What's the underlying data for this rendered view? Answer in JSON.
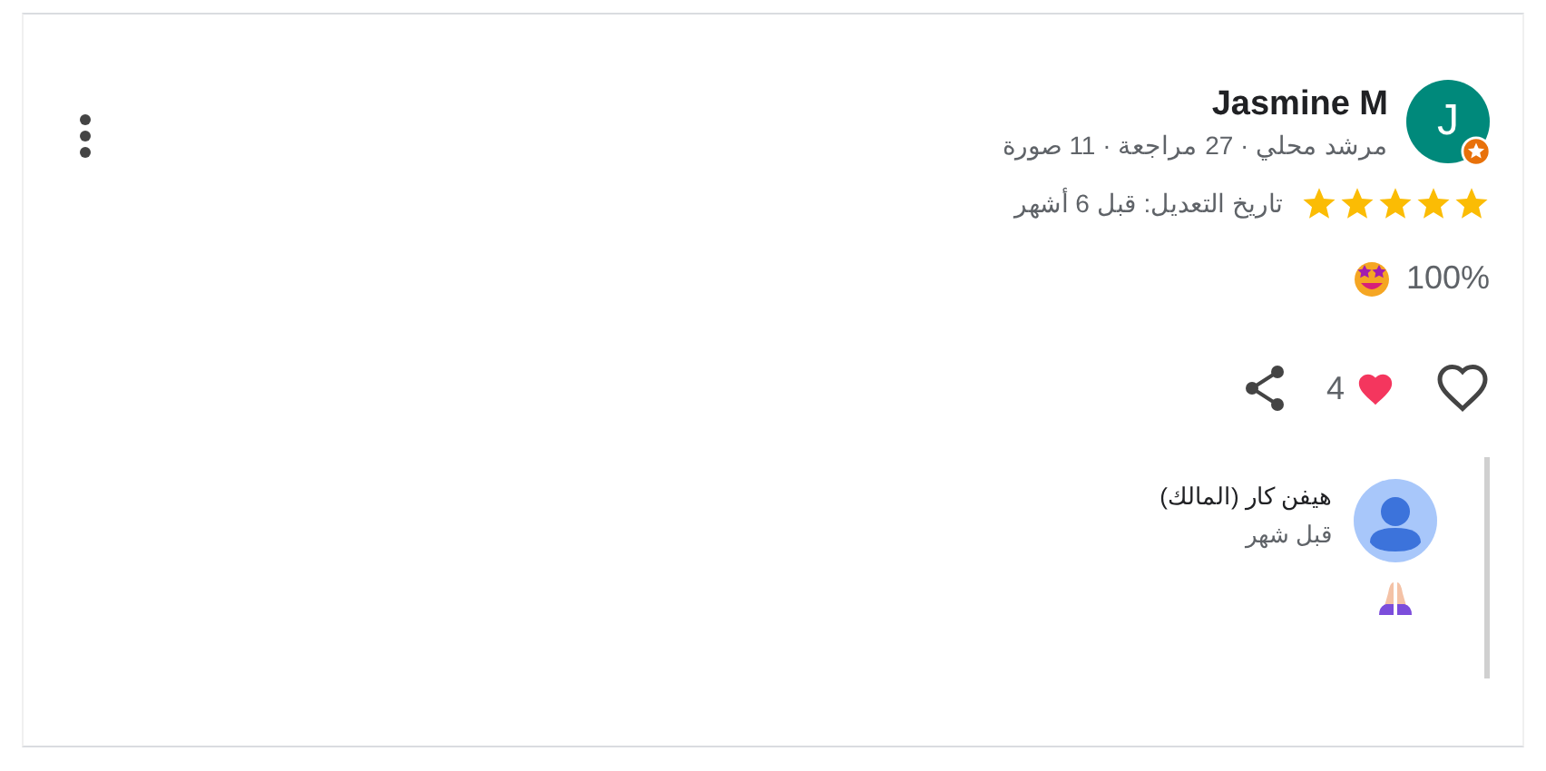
{
  "review": {
    "initial": "J",
    "name": "Jasmine M",
    "meta": "مرشد محلي · 27 مراجعة · 11 صورة",
    "stars": 5,
    "edited": "تاريخ التعديل: قبل 6 أشهر",
    "score": "100%",
    "likes": "4",
    "liked": false
  },
  "reply": {
    "author": "هيفن كار (المالك)",
    "time": "قبل شهر"
  }
}
